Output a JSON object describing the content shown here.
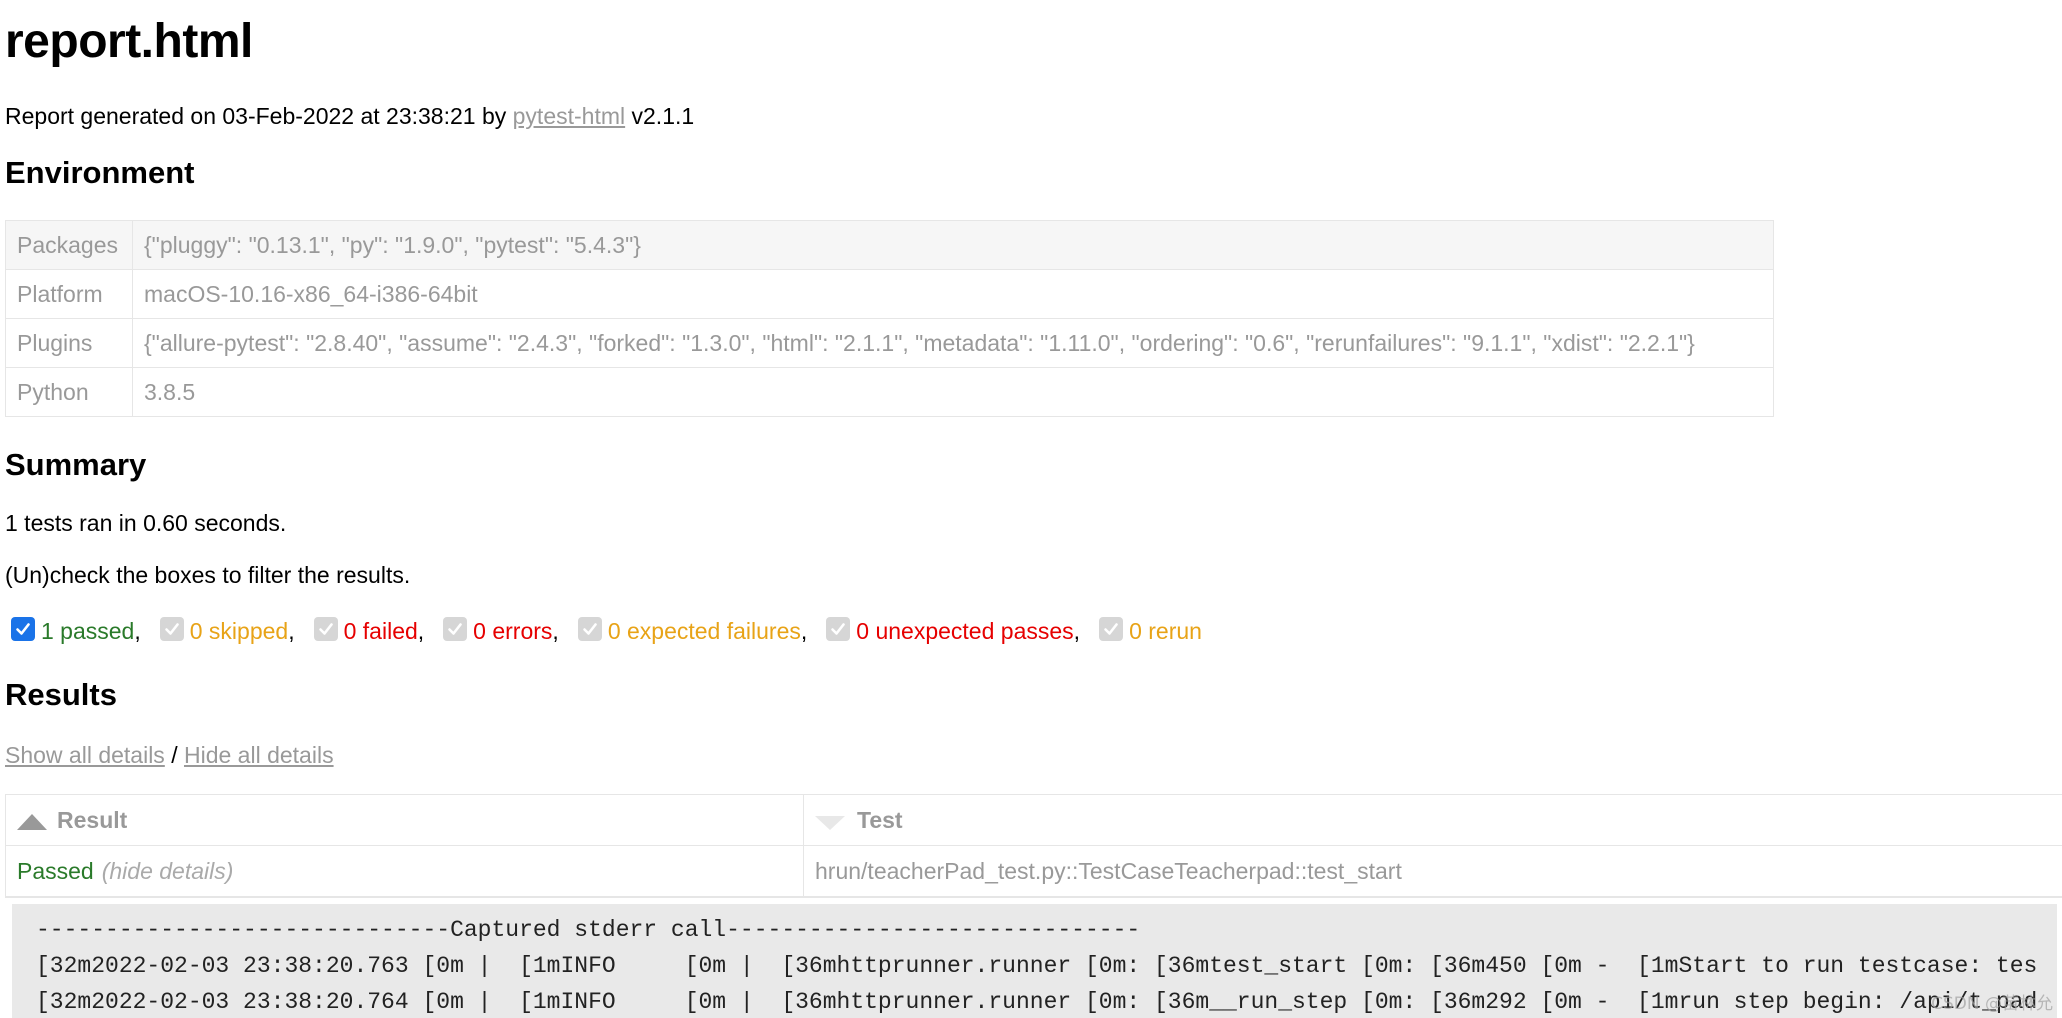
{
  "title": "report.html",
  "generated": {
    "prefix": "Report generated on 03-Feb-2022 at 23:38:21 by ",
    "link": "pytest-html",
    "suffix": " v2.1.1"
  },
  "environment": {
    "heading": "Environment",
    "rows": [
      {
        "key": "Packages",
        "value": "{\"pluggy\": \"0.13.1\", \"py\": \"1.9.0\", \"pytest\": \"5.4.3\"}"
      },
      {
        "key": "Platform",
        "value": "macOS-10.16-x86_64-i386-64bit"
      },
      {
        "key": "Plugins",
        "value": "{\"allure-pytest\": \"2.8.40\", \"assume\": \"2.4.3\", \"forked\": \"1.3.0\", \"html\": \"2.1.1\", \"metadata\": \"1.11.0\", \"ordering\": \"0.6\", \"rerunfailures\": \"9.1.1\", \"xdist\": \"2.2.1\"}"
      },
      {
        "key": "Python",
        "value": "3.8.5"
      }
    ]
  },
  "summary": {
    "heading": "Summary",
    "ran": "1 tests ran in 0.60 seconds.",
    "hint": "(Un)check the boxes to filter the results.",
    "filters": [
      {
        "label": "1 passed",
        "checked": true,
        "disabled": false,
        "color": "#2a7a2a"
      },
      {
        "label": "0 skipped",
        "checked": true,
        "disabled": true,
        "color": "#e8a317"
      },
      {
        "label": "0 failed",
        "checked": true,
        "disabled": true,
        "color": "#e60000"
      },
      {
        "label": "0 errors",
        "checked": true,
        "disabled": true,
        "color": "#e60000"
      },
      {
        "label": "0 expected failures",
        "checked": true,
        "disabled": true,
        "color": "#e8a317"
      },
      {
        "label": "0 unexpected passes",
        "checked": true,
        "disabled": true,
        "color": "#e60000"
      },
      {
        "label": "0 rerun",
        "checked": true,
        "disabled": true,
        "color": "#e8a317"
      }
    ]
  },
  "results": {
    "heading": "Results",
    "show_all": "Show all details",
    "divider": " / ",
    "hide_all": "Hide all details",
    "columns": {
      "result": "Result",
      "test": "Test"
    },
    "rows": [
      {
        "result": "Passed",
        "toggle": "(hide details)",
        "test": "hrun/teacherPad_test.py::TestCaseTeacherpad::test_start"
      }
    ],
    "log_lines": [
      "------------------------------Captured stderr call------------------------------",
      "[32m2022-02-03 23:38:20.763 [0m |  [1mINFO     [0m |  [36mhttprunner.runner [0m: [36mtest_start [0m: [36m450 [0m -  [1mStart to run testcase: tes",
      "[32m2022-02-03 23:38:20.764 [0m |  [1mINFO     [0m |  [36mhttprunner.runner [0m: [36m__run_step [0m: [36m292 [0m -  [1mrun step begin: /api/t_pad"
    ]
  },
  "watermark": "CSDN @苗林允"
}
